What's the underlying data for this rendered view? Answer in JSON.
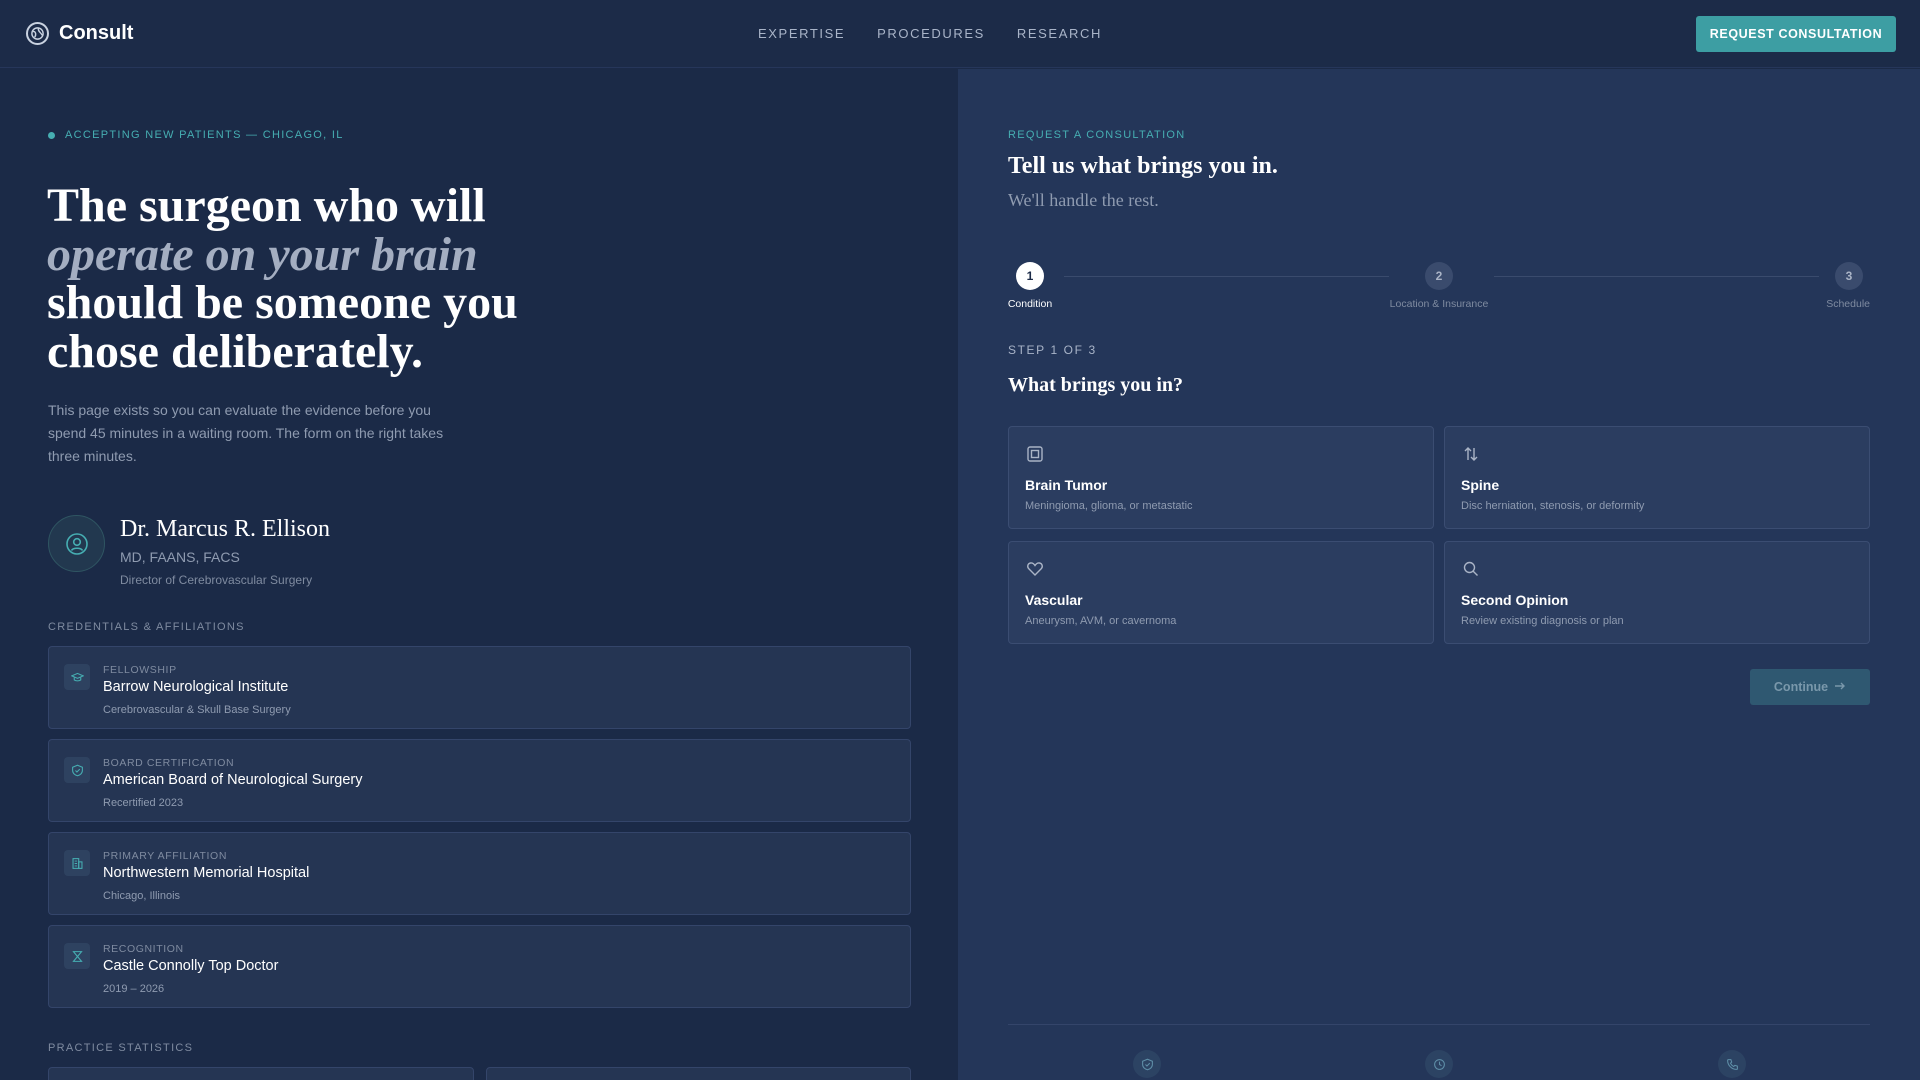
{
  "header": {
    "brand": "Consult",
    "nav": [
      "EXPERTISE",
      "PROCEDURES",
      "RESEARCH"
    ],
    "cta": "REQUEST CONSULTATION"
  },
  "hero": {
    "eyebrow": "ACCEPTING NEW PATIENTS — CHICAGO, IL",
    "line1": "The surgeon who will",
    "line2": "operate on your brain",
    "line3": "should be someone you",
    "line4": "chose deliberately.",
    "intro": "This page exists so you can evaluate the evidence before you spend 45 minutes in a waiting room. The form on the right takes three minutes."
  },
  "doctor": {
    "name": "Dr. Marcus R. Ellison",
    "credentials": "MD, FAANS, FACS",
    "role": "Director of Cerebrovascular Surgery"
  },
  "credentials": {
    "label": "CREDENTIALS & AFFILIATIONS",
    "items": [
      {
        "kicker": "FELLOWSHIP",
        "title": "Barrow Neurological Institute",
        "sub": "Cerebrovascular & Skull Base Surgery",
        "icon": "graduation-icon"
      },
      {
        "kicker": "BOARD CERTIFICATION",
        "title": "American Board of Neurological Surgery",
        "sub": "Recertified 2023",
        "icon": "shield-check-icon"
      },
      {
        "kicker": "PRIMARY AFFILIATION",
        "title": "Northwestern Memorial Hospital",
        "sub": "Chicago, Illinois",
        "icon": "hospital-icon"
      },
      {
        "kicker": "RECOGNITION",
        "title": "Castle Connolly Top Doctor",
        "sub": "2019 – 2026",
        "icon": "award-icon"
      }
    ]
  },
  "stats": {
    "label": "PRACTICE STATISTICS"
  },
  "form": {
    "eyebrow": "REQUEST A CONSULTATION",
    "title": "Tell us what brings you in.",
    "subtitle": "We'll handle the rest.",
    "steps": [
      {
        "number": "1",
        "label": "Condition"
      },
      {
        "number": "2",
        "label": "Location & Insurance"
      },
      {
        "number": "3",
        "label": "Schedule"
      }
    ],
    "step_count": "STEP 1 OF 3",
    "question": "What brings you in?",
    "options": [
      {
        "title": "Brain Tumor",
        "desc": "Meningioma, glioma, or metastatic",
        "icon": "chip-icon"
      },
      {
        "title": "Spine",
        "desc": "Disc herniation, stenosis, or deformity",
        "icon": "arrows-up-down-icon"
      },
      {
        "title": "Vascular",
        "desc": "Aneurysm, AVM, or cavernoma",
        "icon": "heart-icon"
      },
      {
        "title": "Second Opinion",
        "desc": "Review existing diagnosis or plan",
        "icon": "search-icon"
      }
    ],
    "continue": "Continue"
  },
  "colors": {
    "accent": "#3d9ea3",
    "teal_text": "#46aeb2",
    "left_bg": "#1b2a47",
    "right_bg": "#243659"
  }
}
